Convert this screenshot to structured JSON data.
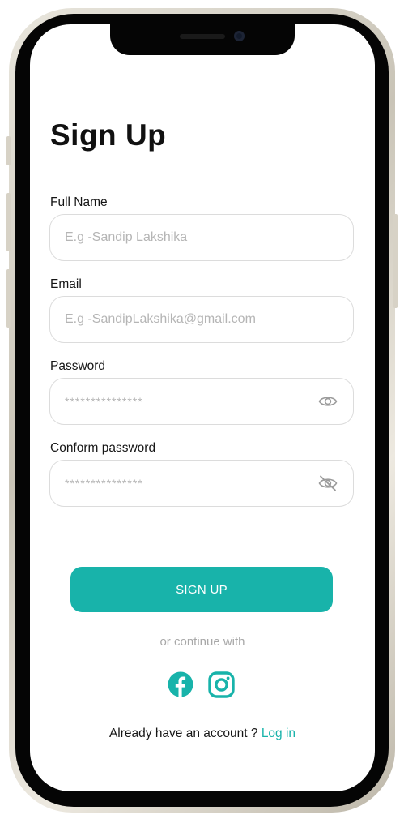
{
  "signup": {
    "title": "Sign Up",
    "full_name": {
      "label": "Full Name",
      "placeholder": "E.g -Sandip Lakshika"
    },
    "email": {
      "label": "Email",
      "placeholder": "E.g -SandipLakshika@gmail.com"
    },
    "password": {
      "label": "Password",
      "placeholder": "***************",
      "visibility_icon": "eye-icon"
    },
    "confirm_password": {
      "label": "Conform password",
      "placeholder": "***************",
      "visibility_icon": "eye-off-icon"
    },
    "submit_label": "SIGN UP",
    "continue_text": "or continue with",
    "social": [
      {
        "name": "facebook-icon"
      },
      {
        "name": "instagram-icon"
      }
    ],
    "footer_text": "Already have an account ?",
    "login_link": "Log in"
  },
  "colors": {
    "accent": "#18b3aa",
    "placeholder": "#b5b5b5",
    "input_border": "#dcdcdc",
    "muted_text": "#a8a8a8"
  }
}
